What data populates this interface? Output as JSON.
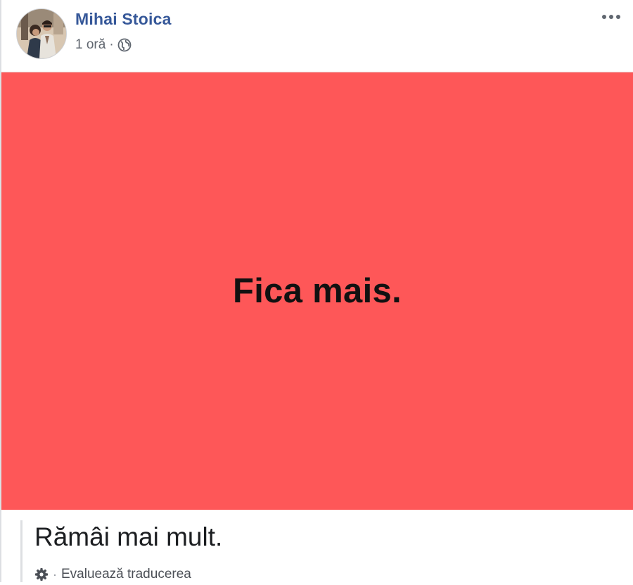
{
  "post": {
    "author": "Mihai Stoica",
    "time": "1 oră",
    "separator": "·",
    "image_text": "Fica mais.",
    "translated_text": "Rămâi mai mult.",
    "rate_translation_label": "Evaluează traducerea"
  },
  "icons": {
    "privacy": "globe-icon",
    "options": "more-options-icon",
    "settings": "gear-icon"
  },
  "colors": {
    "author_link": "#365899",
    "image_background": "#fe5758",
    "meta_text": "#616770"
  }
}
